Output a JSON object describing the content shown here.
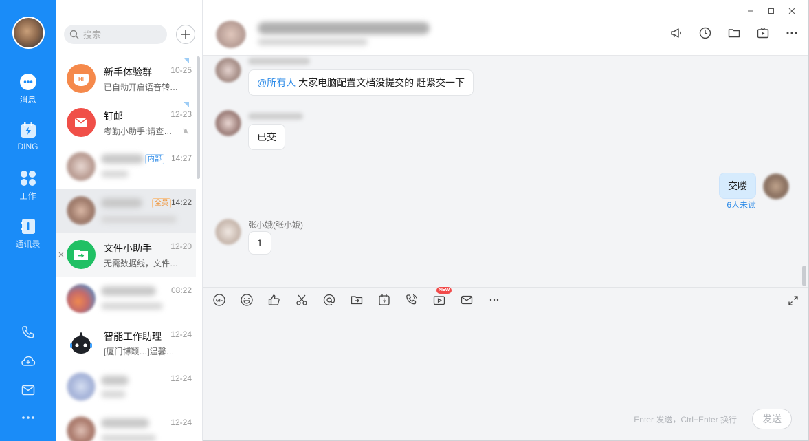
{
  "nav": {
    "items": [
      {
        "label": "消息",
        "icon": "chat-icon"
      },
      {
        "label": "DING",
        "icon": "ding-icon"
      },
      {
        "label": "工作",
        "icon": "apps-icon"
      },
      {
        "label": "通讯录",
        "icon": "contacts-icon"
      }
    ],
    "bottom_icons": [
      "phone-icon",
      "cloud-icon",
      "mail-icon",
      "more-icon"
    ]
  },
  "search": {
    "placeholder": "搜索"
  },
  "conversations": [
    {
      "name": "新手体验群",
      "time": "10-25",
      "preview": "已自动开启语音转…",
      "avatar_color": "#f5894b"
    },
    {
      "name": "钉邮",
      "time": "12-23",
      "preview": "考勤小助手:请查…",
      "avatar_color": "#f04f48"
    },
    {
      "name": "",
      "time": "14:27",
      "preview": "",
      "badge": "内部"
    },
    {
      "name": "",
      "time": "14:22",
      "preview": "",
      "badge": "全员"
    },
    {
      "name": "文件小助手",
      "time": "12-20",
      "preview": "无需数据线，文件…",
      "avatar_color": "#20c064"
    },
    {
      "name": "",
      "time": "08:22",
      "preview": ""
    },
    {
      "name": "智能工作助理",
      "time": "12-24",
      "preview": "[厦门博颖…]温馨…"
    },
    {
      "name": "",
      "time": "12-24",
      "preview": ""
    },
    {
      "name": "",
      "time": "12-24",
      "preview": ""
    }
  ],
  "messages": [
    {
      "mention": "@所有人",
      "text": " 大家电脑配置文档没提交的 赶紧交一下"
    },
    {
      "text": "已交"
    },
    {
      "text": "交喽",
      "status": "6人未读"
    },
    {
      "sender": "张小娥(张小娥)",
      "text": "1"
    }
  ],
  "toolbar": {
    "icons": [
      "gif-icon",
      "emoji-icon",
      "thumbs-up-icon",
      "scissors-icon",
      "at-icon",
      "folder-icon",
      "ding-icon",
      "phone-call-icon",
      "video-icon",
      "mail-icon",
      "more-icon"
    ],
    "new_badge": "NEW"
  },
  "composer": {
    "hint": "Enter 发送，Ctrl+Enter 换行",
    "send_label": "发送"
  },
  "colors": {
    "nav_bg": "#1a8cf8",
    "accent": "#2f8ce8"
  }
}
